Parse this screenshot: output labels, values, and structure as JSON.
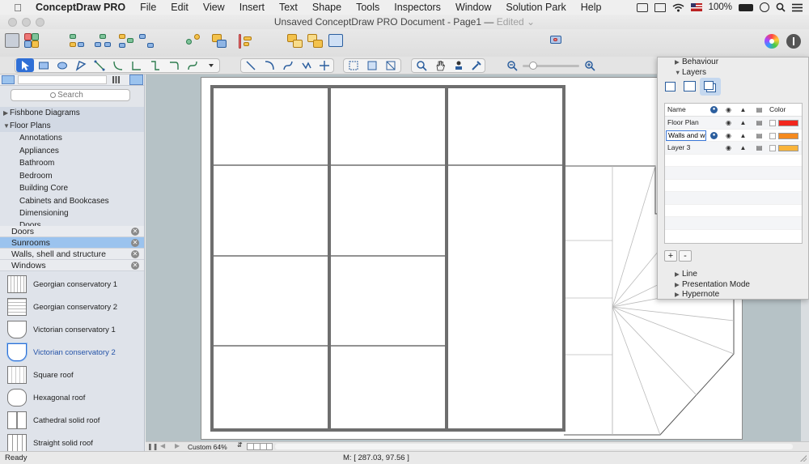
{
  "menubar": {
    "items": [
      "ConceptDraw PRO",
      "File",
      "Edit",
      "View",
      "Insert",
      "Text",
      "Shape",
      "Tools",
      "Inspectors",
      "Window",
      "Solution Park",
      "Help"
    ],
    "battery": "100%"
  },
  "window": {
    "title": "Unsaved ConceptDraw PRO Document - Page1 —",
    "edited": "Edited"
  },
  "library": {
    "search_placeholder": "Search",
    "categories": [
      {
        "label": "Fishbone Diagrams",
        "expanded": false
      },
      {
        "label": "Floor Plans",
        "expanded": true
      }
    ],
    "floor_plan_items": [
      "Annotations",
      "Appliances",
      "Bathroom",
      "Bedroom",
      "Building Core",
      "Cabinets and Bookcases",
      "Dimensioning",
      "Doors"
    ],
    "open_libraries": [
      "Doors",
      "Sunrooms",
      "Walls, shell and structure",
      "Windows"
    ],
    "active_library": "Sunrooms",
    "shapes": [
      "Georgian conservatory 1",
      "Georgian conservatory 2",
      "Victorian conservatory 1",
      "Victorian conservatory 2",
      "Square roof",
      "Hexagonal roof",
      "Cathedral solid roof",
      "Straight solid roof"
    ],
    "selected_shape": "Victorian conservatory 2"
  },
  "panel": {
    "sections_top": [
      "Behaviour",
      "Layers"
    ],
    "sections_bottom": [
      "Line",
      "Presentation Mode",
      "Hypernote"
    ],
    "layers_header": {
      "name": "Name",
      "color": "Color"
    },
    "layers": [
      {
        "name": "Floor Plan",
        "color": "#f2261d",
        "active": false
      },
      {
        "name": "Walls and w",
        "color": "#f58a1f",
        "active": true
      },
      {
        "name": "Layer 3",
        "color": "#f9b43a",
        "active": false
      }
    ],
    "add_label": "+",
    "remove_label": "-"
  },
  "canvas": {
    "zoom_label": "Custom 64%"
  },
  "status": {
    "ready": "Ready",
    "mouse": "M: [ 287.03, 97.56 ]"
  }
}
